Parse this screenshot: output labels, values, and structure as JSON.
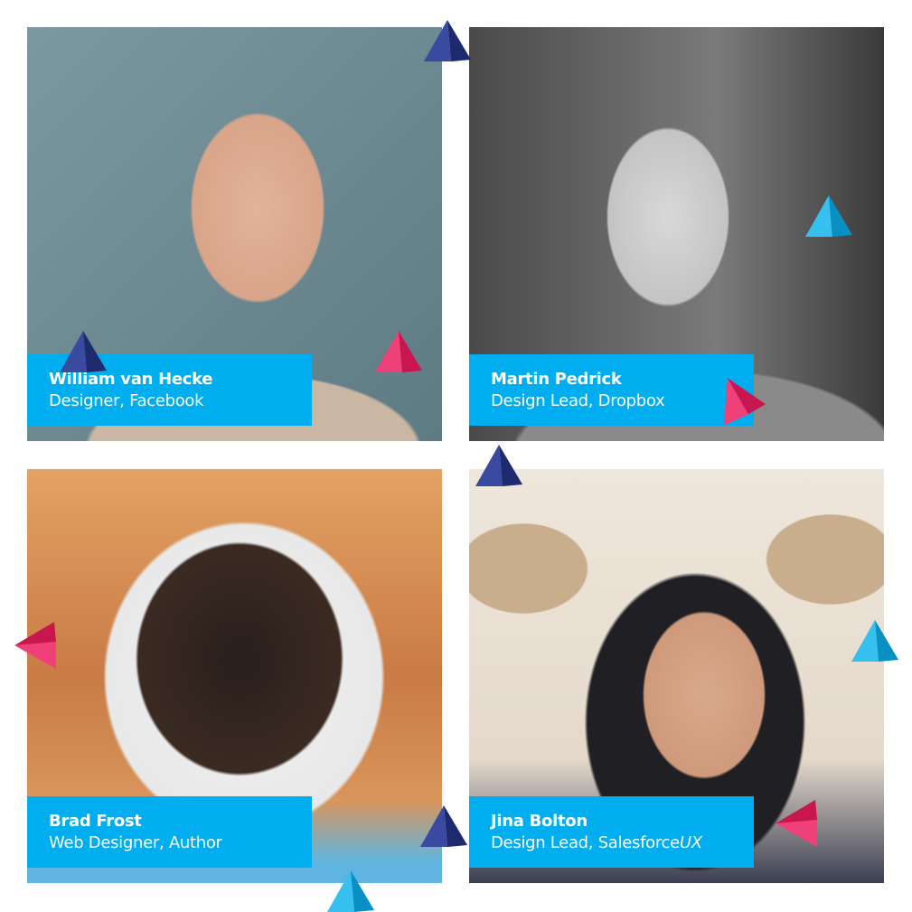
{
  "speakers": [
    {
      "name": "William van Hecke",
      "role": "Designer, Facebook"
    },
    {
      "name": "Martin Pedrick",
      "role": "Design Lead, Dropbox"
    },
    {
      "name": "Brad Frost",
      "role": "Web Designer, Author"
    },
    {
      "name": "Jina Bolton",
      "role_prefix": "Design Lead, Salesforce",
      "role_emphasis": "UX"
    }
  ],
  "colors": {
    "label_bg": "#00adee",
    "navy": "#2a3585",
    "pink": "#e0205f",
    "cyan": "#17a8e0"
  }
}
